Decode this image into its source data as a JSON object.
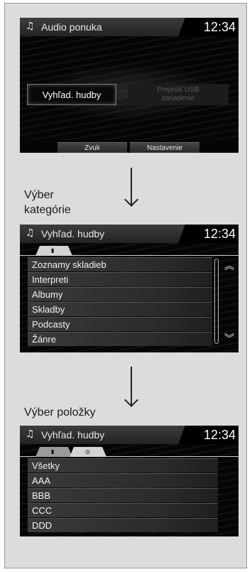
{
  "screen1": {
    "title": "Audio ponuka",
    "clock": "12:34",
    "search_button": "Vyhľad. hudby",
    "usb_button_line1": "Prepnúť USB",
    "usb_button_line2": "zariadenie",
    "sound_button": "Zvuk",
    "settings_button": "Nastavenie"
  },
  "step1_caption": {
    "line1": "Výber",
    "line2": "kategórie"
  },
  "screen2": {
    "title": "Vyhľad. hudby",
    "clock": "12:34",
    "items": [
      "Zoznamy skladieb",
      "Interpreti",
      "Albumy",
      "Skladby",
      "Podcasty",
      "Žánre"
    ]
  },
  "step2_caption": "Výber položky",
  "screen3": {
    "title": "Vyhľad. hudby",
    "clock": "12:34",
    "items": [
      "Všetky",
      "AAA",
      "BBB",
      "CCC",
      "DDD"
    ]
  },
  "icons": {
    "music": "music-note-icon",
    "usb": "usb-device-icon",
    "disc": "disc-icon",
    "scroll_up": "chevron-up-icon",
    "scroll_down": "chevron-down-icon"
  }
}
